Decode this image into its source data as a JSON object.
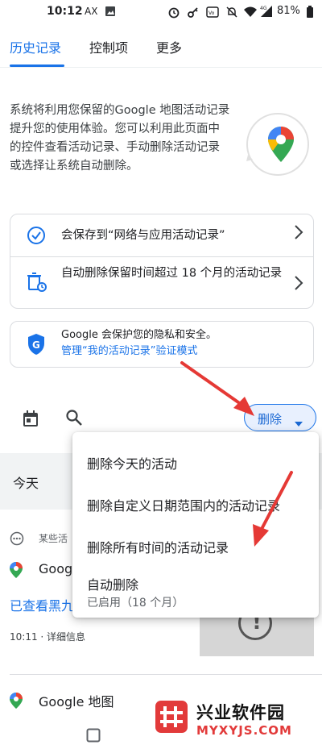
{
  "status_bar": {
    "time": "10:12",
    "carrier": "AX",
    "battery": "81%"
  },
  "tabs": [
    {
      "label": "历史记录"
    },
    {
      "label": "控制项"
    },
    {
      "label": "更多"
    }
  ],
  "intro_text": "系统将利用您保留的Google 地图活动记录提升您的使用体验。您可以利用此页面中的控件查看活动记录、手动删除活动记录或选择让系统自动删除。",
  "settings_card": {
    "row1": "会保存到“网络与应用活动记录”",
    "row2": "自动删除保留时间超过 18 个月的活动记录"
  },
  "privacy_card": {
    "text": "Google 会保护您的隐私和安全。",
    "link": "管理“我的活动记录”验证模式"
  },
  "toolbar": {
    "delete_label": "删除"
  },
  "today_label": "今天",
  "partial_items": {
    "meta": "某些活",
    "title": "Goog",
    "link": "已查看黑九",
    "time": "10:11 · 详细信息",
    "next_title": "Google 地图"
  },
  "menu": {
    "item1": "删除今天的活动",
    "item2": "删除自定义日期范围内的活动记录",
    "item3": "删除所有时间的活动记录",
    "item4": "自动删除",
    "item4_sub": "已启用（18 个月）"
  },
  "watermark": {
    "name": "兴业软件园",
    "url": "MYXYJS.COM"
  },
  "colors": {
    "accent": "#1a73e8",
    "arrow": "#e53935",
    "watermark": "#e23a3a"
  }
}
